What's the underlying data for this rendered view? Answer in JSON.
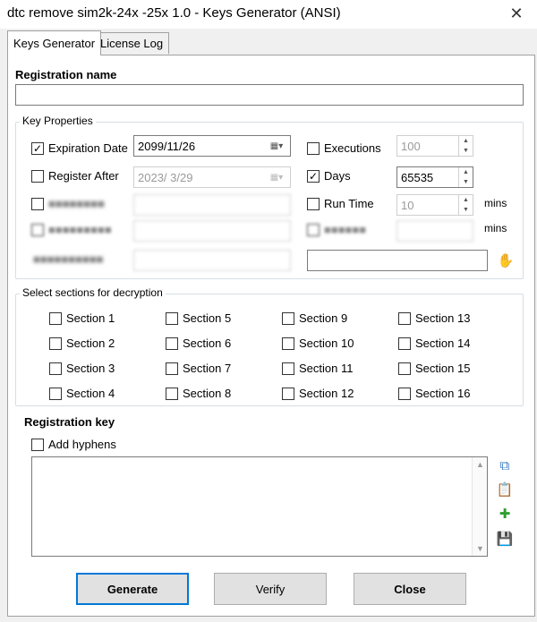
{
  "window": {
    "title": "dtc remove sim2k-24x -25x 1.0 - Keys Generator (ANSI)",
    "close_glyph": "✕"
  },
  "tabs": [
    {
      "label": "Keys Generator",
      "active": true
    },
    {
      "label": "License Log",
      "active": false
    }
  ],
  "registration_name": {
    "label": "Registration name",
    "value": ""
  },
  "key_properties": {
    "title": "Key Properties",
    "expiration_date": {
      "label": "Expiration Date",
      "checked": true,
      "value": "2099/11/26"
    },
    "register_after": {
      "label": "Register After",
      "checked": false,
      "value": "2023/ 3/29"
    },
    "executions": {
      "label": "Executions",
      "checked": false,
      "value": "100"
    },
    "days": {
      "label": "Days",
      "checked": true,
      "value": "65535"
    },
    "run_time": {
      "label": "Run Time",
      "checked": false,
      "value": "10",
      "unit": "mins"
    },
    "unit_mins": "mins"
  },
  "sections": {
    "title": "Select sections for decryption",
    "items": [
      "Section 1",
      "Section 2",
      "Section 3",
      "Section 4",
      "Section 5",
      "Section 6",
      "Section 7",
      "Section 8",
      "Section 9",
      "Section 10",
      "Section 11",
      "Section 12",
      "Section 13",
      "Section 14",
      "Section 15",
      "Section 16"
    ]
  },
  "registration_key": {
    "label": "Registration key",
    "add_hyphens": {
      "label": "Add hyphens",
      "checked": false
    },
    "value": ""
  },
  "buttons": {
    "generate": "Generate",
    "verify": "Verify",
    "close": "Close"
  },
  "icons": {
    "copy": "copy-icon",
    "paste": "paste-icon",
    "add": "add-file-icon",
    "save": "save-icon",
    "hand": "hand-icon"
  }
}
